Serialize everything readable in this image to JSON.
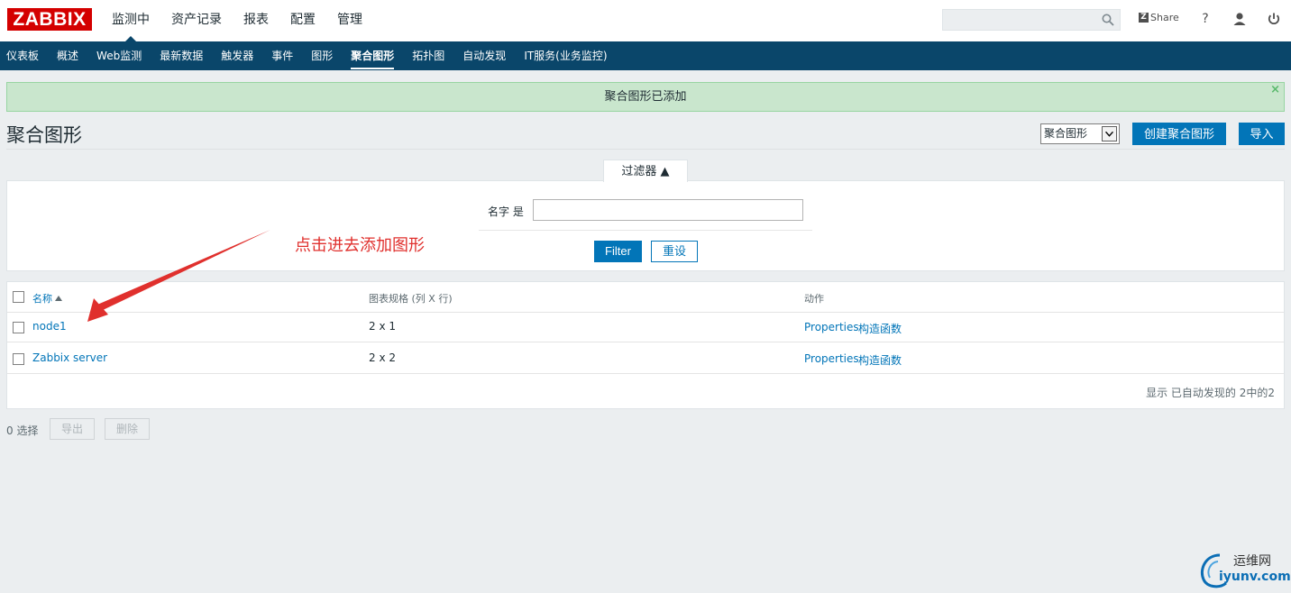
{
  "header": {
    "logo_text": "ZABBIX",
    "nav": [
      "监测中",
      "资产记录",
      "报表",
      "配置",
      "管理"
    ],
    "active_nav": "监测中",
    "search_placeholder": "",
    "share_label": "Share",
    "help_label": "?"
  },
  "subnav": {
    "items": [
      "仪表板",
      "概述",
      "Web监测",
      "最新数据",
      "触发器",
      "事件",
      "图形",
      "聚合图形",
      "拓扑图",
      "自动发现",
      "IT服务(业务监控)"
    ],
    "active": "聚合图形"
  },
  "message": {
    "text": "聚合图形已添加",
    "close": "×"
  },
  "page": {
    "title": "聚合图形",
    "select_value": "聚合图形",
    "create_button": "创建聚合图形",
    "import_button": "导入"
  },
  "filter": {
    "tab_label": "过滤器 ▲",
    "name_label": "名字 是",
    "name_value": "",
    "apply_button": "Filter",
    "reset_button": "重设"
  },
  "annotation": {
    "text": "点击进去添加图形"
  },
  "table": {
    "columns": [
      "名称",
      "图表规格 (列 X 行)",
      "动作"
    ],
    "rows": [
      {
        "name": "node1",
        "dims": "2 x 1",
        "action_properties": "Properties",
        "action_constructor": "构造函数"
      },
      {
        "name": "Zabbix server",
        "dims": "2 x 2",
        "action_properties": "Properties",
        "action_constructor": "构造函数"
      }
    ],
    "footer": "显示 已自动发现的 2中的2"
  },
  "bottom": {
    "selected_count": "0 选择",
    "export_button": "导出",
    "delete_button": "删除"
  },
  "watermark": {
    "line1": "运维网",
    "line2": "iyunv.com"
  },
  "colors": {
    "brand_red": "#d40000",
    "nav_blue": "#0a466a",
    "link_blue": "#0275b8",
    "success_bg": "#c9e6cd",
    "annotation_red": "#e0302d"
  }
}
